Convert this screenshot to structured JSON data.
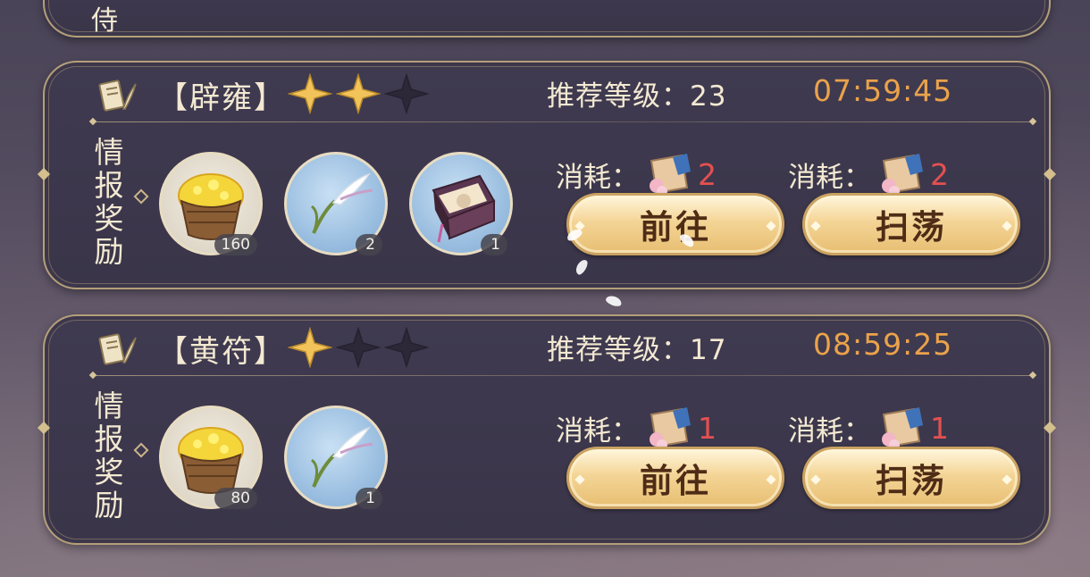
{
  "top_card": {
    "label_fragment": "侍"
  },
  "quests": [
    {
      "title": "【辟雍】",
      "stars_filled": 2,
      "stars_total": 3,
      "level_text": "推荐等级：23",
      "timer": "07:59:45",
      "reward_label": [
        "情",
        "报",
        "奖",
        "励"
      ],
      "items": [
        {
          "icon": "gold-basket-icon",
          "count": "160"
        },
        {
          "icon": "white-feather-icon",
          "count": "2"
        },
        {
          "icon": "treasure-chest-icon",
          "count": "1"
        }
      ],
      "go_cost_label": "消耗：",
      "go_cost_value": "2",
      "sweep_cost_label": "消耗：",
      "sweep_cost_value": "2",
      "go_button": "前往",
      "sweep_button": "扫荡"
    },
    {
      "title": "【黄符】",
      "stars_filled": 1,
      "stars_total": 3,
      "level_text": "推荐等级：17",
      "timer": "08:59:25",
      "reward_label": [
        "情",
        "报",
        "奖",
        "励"
      ],
      "items": [
        {
          "icon": "gold-basket-icon",
          "count": "80"
        },
        {
          "icon": "white-feather-icon",
          "count": "1"
        }
      ],
      "go_cost_label": "消耗：",
      "go_cost_value": "1",
      "sweep_cost_label": "消耗：",
      "sweep_cost_value": "1",
      "go_button": "前往",
      "sweep_button": "扫荡"
    }
  ],
  "colors": {
    "timer": "#eba24a",
    "cost_number": "#e45050",
    "button_text": "#4e2c16",
    "frame_gold": "#b49f7a"
  }
}
